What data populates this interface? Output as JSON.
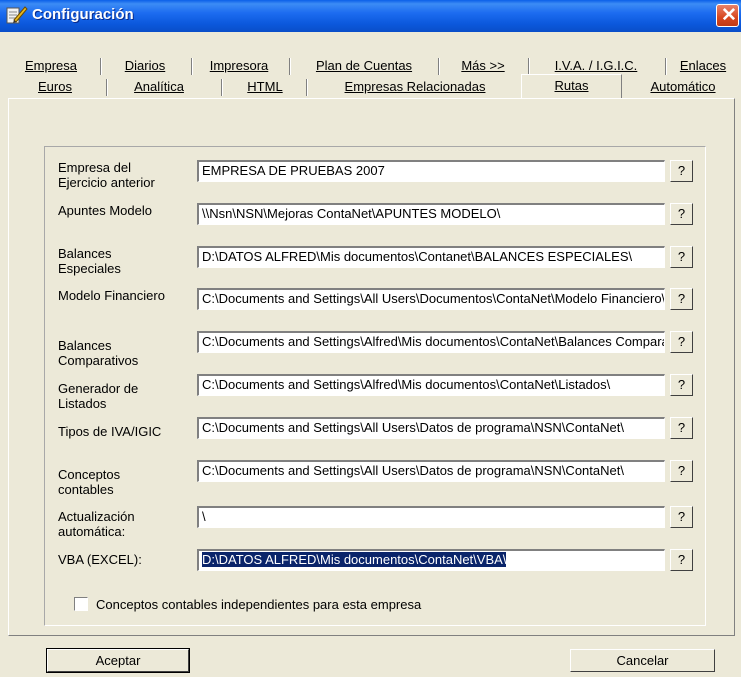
{
  "window": {
    "title": "Configuración"
  },
  "tabs_row1": [
    "Empresa",
    "Diarios",
    "Impresora",
    "Plan de Cuentas",
    "Más >>",
    "I.V.A. / I.G.I.C.",
    "Enlaces"
  ],
  "tabs_row2": [
    "Euros",
    "Analítica",
    "HTML",
    "Empresas Relacionadas",
    "Rutas",
    "Automático"
  ],
  "active_tab": "Rutas",
  "fields": [
    {
      "label": "Empresa del\nEjercicio anterior",
      "value": "EMPRESA DE PRUEBAS 2007"
    },
    {
      "label": "Apuntes Modelo",
      "value": "\\\\Nsn\\NSN\\Mejoras ContaNet\\APUNTES MODELO\\"
    },
    {
      "label": "Balances\nEspeciales",
      "value": "D:\\DATOS ALFRED\\Mis documentos\\Contanet\\BALANCES ESPECIALES\\"
    },
    {
      "label": "Modelo Financiero",
      "value": "C:\\Documents and Settings\\All Users\\Documentos\\ContaNet\\Modelo Financiero\\"
    },
    {
      "label": "Balances\nComparativos",
      "value": "C:\\Documents and Settings\\Alfred\\Mis documentos\\ContaNet\\Balances Comparativos\\"
    },
    {
      "label": "Generador de\nListados",
      "value": "C:\\Documents and Settings\\Alfred\\Mis documentos\\ContaNet\\Listados\\"
    },
    {
      "label": "Tipos de IVA/IGIC",
      "value": "C:\\Documents and Settings\\All Users\\Datos de programa\\NSN\\ContaNet\\"
    },
    {
      "label": "Conceptos\ncontables",
      "value": "C:\\Documents and Settings\\All Users\\Datos de programa\\NSN\\ContaNet\\"
    },
    {
      "label": "Actualización\nautomática:",
      "value": "\\"
    },
    {
      "label": "VBA (EXCEL):",
      "value": "D:\\DATOS ALFRED\\Mis documentos\\ContaNet\\VBA\\"
    }
  ],
  "help_button_label": "?",
  "checkbox": {
    "label": "Conceptos contables independientes para esta empresa",
    "checked": false
  },
  "buttons": {
    "accept": "Aceptar",
    "cancel": "Cancelar"
  }
}
